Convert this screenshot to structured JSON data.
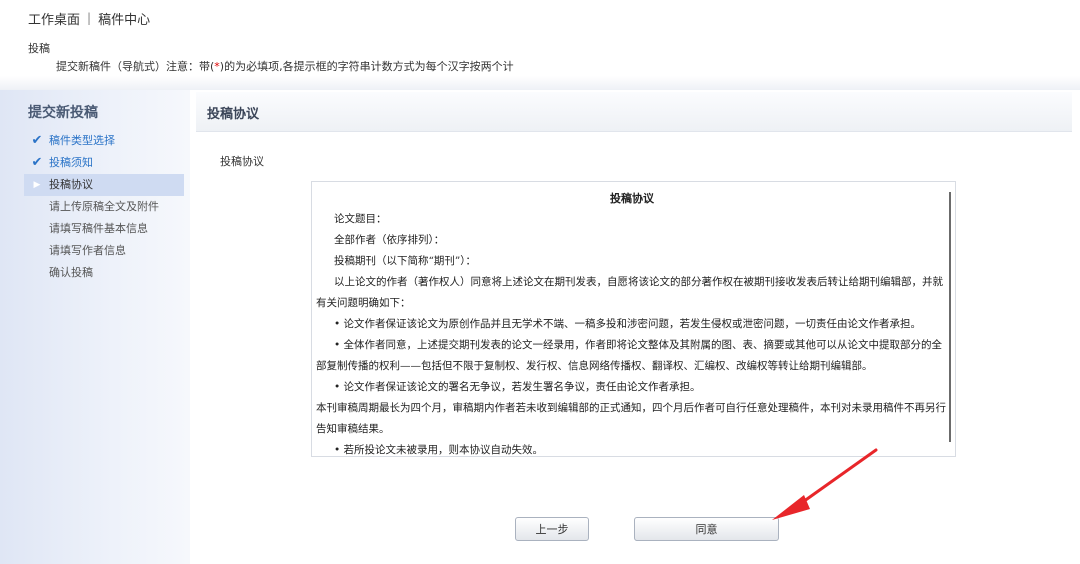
{
  "topbar": {
    "workspace": "工作桌面",
    "separator": "|",
    "manuscript_center": "稿件中心"
  },
  "notice": {
    "title": "投稿",
    "prefix": "提交新稿件（导航式）注意：带(",
    "required_mark": "*",
    "suffix": ")的为必填项,各提示框的字符串计数方式为每个汉字按两个计"
  },
  "sidebar": {
    "title": "提交新投稿",
    "steps": [
      {
        "label": "稿件类型选择",
        "state": "done"
      },
      {
        "label": "投稿须知",
        "state": "done"
      },
      {
        "label": "投稿协议",
        "state": "current"
      },
      {
        "label": "请上传原稿全文及附件",
        "state": "pending"
      },
      {
        "label": "请填写稿件基本信息",
        "state": "pending"
      },
      {
        "label": "请填写作者信息",
        "state": "pending"
      },
      {
        "label": "确认投稿",
        "state": "pending"
      }
    ]
  },
  "main": {
    "header": "投稿协议",
    "subheader": "投稿协议"
  },
  "agreement": {
    "title": "投稿协议",
    "p1": "论文题目：",
    "p2": "全部作者（依序排列）：",
    "p3": "投稿期刊（以下简称“期刊”）：",
    "p4": "以上论文的作者（著作权人）同意将上述论文在期刊发表，自愿将该论文的部分著作权在被期刊接收发表后转让给期刊编辑部，并就有关问题明确如下：",
    "p5": "• 论文作者保证该论文为原创作品并且无学术不端、一稿多投和涉密问题，若发生侵权或泄密问题，一切责任由论文作者承担。",
    "p6": "• 全体作者同意，上述提交期刊发表的论文一经录用，作者即将论文整体及其附属的图、表、摘要或其他可以从论文中提取部分的全部复制传播的权利——包括但不限于复制权、发行权、信息网络传播权、翻译权、汇编权、改编权等转让给期刊编辑部。",
    "p7": "• 论文作者保证该论文的署名无争议，若发生署名争议，责任由论文作者承担。",
    "p8": "本刊审稿周期最长为四个月，审稿期内作者若未收到编辑部的正式通知，四个月后作者可自行任意处理稿件，本刊对未录用稿件不再另行告知审稿结果。",
    "p9": "• 若所投论文未被录用，则本协议自动失效。"
  },
  "buttons": {
    "prev": "上一步",
    "agree": "同意"
  },
  "icons": {
    "done": "checkmark-icon",
    "current": "triangle-right-icon",
    "annotation": "red-arrow"
  },
  "colors": {
    "link_blue": "#2a73c7",
    "active_step_bg": "#cfdbf2",
    "annotation_red": "#e8262a"
  }
}
